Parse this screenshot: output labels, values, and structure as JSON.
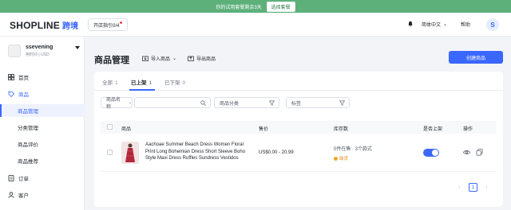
{
  "banner": {
    "text": "你的试用套餐剩余3天",
    "button": "选择套餐"
  },
  "header": {
    "logo": "SHOPLINE",
    "logo_cn": "跨境",
    "guide": "开店指引0/4",
    "language": "简体中文",
    "help": "帮助",
    "avatar_letter": "S"
  },
  "sidebar": {
    "store_name": "ssevening",
    "store_sub": "用时间 | USD",
    "items": [
      {
        "label": "首页",
        "icon": "home-icon"
      },
      {
        "label": "商品",
        "icon": "tag-icon"
      },
      {
        "label": "商品管理"
      },
      {
        "label": "分类管理"
      },
      {
        "label": "商品评价"
      },
      {
        "label": "商品推荐"
      },
      {
        "label": "订单",
        "icon": "order-icon"
      },
      {
        "label": "客户",
        "icon": "user-icon"
      }
    ]
  },
  "main": {
    "title": "商品管理",
    "import": "导入商品",
    "export": "导出商品",
    "create": "创建商品",
    "tabs": [
      {
        "label": "全部",
        "count": "1"
      },
      {
        "label": "已上架",
        "count": "1"
      },
      {
        "label": "已下架",
        "count": "0"
      }
    ],
    "filters": {
      "name": "商品名称",
      "category": "商品分类",
      "tags": "标签"
    },
    "columns": [
      "商品",
      "售价",
      "库存数",
      "是否上架",
      "操作"
    ],
    "rows": [
      {
        "name": "Aachoae Summer Beach Dress Women Floral Print Long Bohemian Dress Short Sleeve Boho Style Maxi Dress Ruffles Sundress Vestidos",
        "price": "US$0.00 - 20.99",
        "stock": "0件在售 · 3个款式",
        "stock_status": "缺货",
        "listed": true
      }
    ],
    "pagination": {
      "current": "1"
    }
  },
  "colors": {
    "accent": "#3a67ff",
    "banner": "#5db07a",
    "warning": "#f5a623"
  }
}
